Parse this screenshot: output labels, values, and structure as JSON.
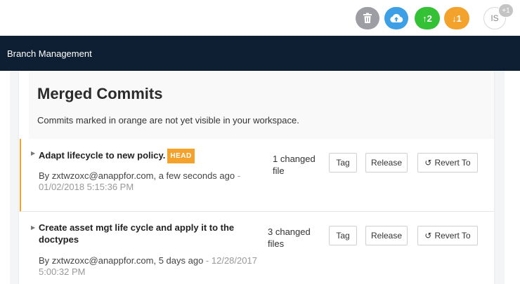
{
  "topbar": {
    "icons": [
      "trash-icon",
      "cloud-upload-icon",
      "arrow-up-icon",
      "arrow-down-icon"
    ],
    "push_count": "2",
    "pull_count": "1",
    "user_initials": "IS",
    "user_badge": "+1",
    "colors": {
      "trash": "#9d9ea4",
      "cloud": "#3d9fe6",
      "push": "#34c136",
      "pull": "#f3a22b"
    }
  },
  "nav": {
    "title": "Branch Management"
  },
  "page": {
    "title": "Merged Commits",
    "subtitle": "Commits marked in orange are not yet visible in your workspace."
  },
  "commits": [
    {
      "title": "Adapt lifecycle to new policy.",
      "badge": "HEAD",
      "author_line": "By zxtwzoxc@anappfor.com, a few seconds ago",
      "date_line": "01/02/2018 5:15:36 PM",
      "changed_line1": "1 changed",
      "changed_line2": "file",
      "tag_label": "Tag",
      "release_label": "Release",
      "revert_label": "Revert To"
    },
    {
      "title_line1": "Create asset mgt life cycle and apply it to the",
      "title_line2": "doctypes",
      "author_line": "By zxtwzoxc@anappfor.com, 5 days ago",
      "date_part1": "12/28/2017",
      "date_part2": "5:00:32 PM",
      "changed_line1": "3 changed",
      "changed_line2": "files",
      "tag_label": "Tag",
      "release_label": "Release",
      "revert_label": "Revert To"
    }
  ],
  "colors": {
    "nav_bg": "#0f1f33",
    "accent": "#f3a22b"
  }
}
